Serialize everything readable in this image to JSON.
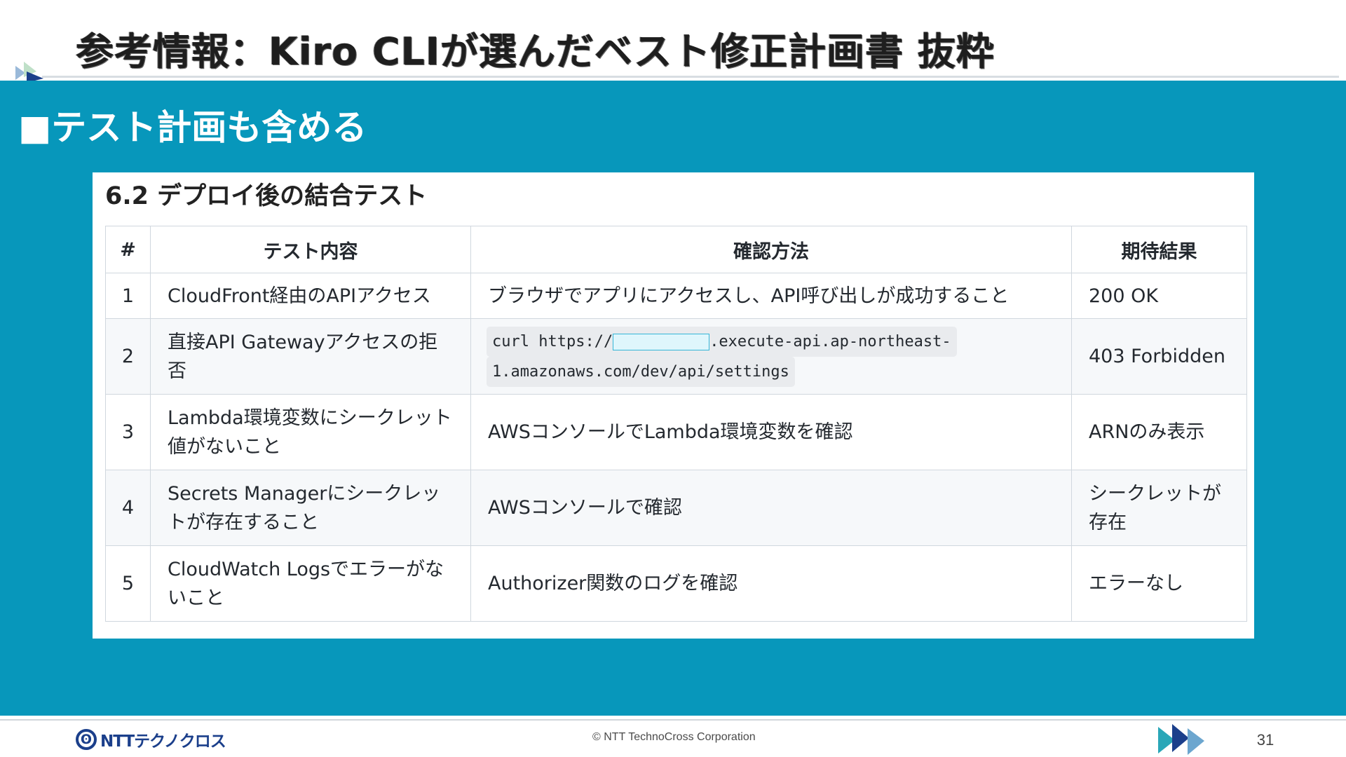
{
  "header": {
    "title": "参考情報：Kiro CLIが選んだベスト修正計画書 抜粋"
  },
  "section": {
    "heading": "■テスト計画も含める"
  },
  "card": {
    "title": "6.2 デプロイ後の結合テスト",
    "columns": [
      "#",
      "テスト内容",
      "確認方法",
      "期待結果"
    ],
    "rows": [
      {
        "num": "1",
        "content": "CloudFront経由のAPIアクセス",
        "method": "ブラウザでアプリにアクセスし、API呼び出しが成功すること",
        "expected": "200 OK"
      },
      {
        "num": "2",
        "content": "直接API Gatewayアクセスの拒否",
        "method_code": {
          "prefix": "curl https://",
          "suffix": ".execute-api.ap-northeast-",
          "line2": "1.amazonaws.com/dev/api/settings"
        },
        "expected": "403 Forbidden"
      },
      {
        "num": "3",
        "content": "Lambda環境変数にシークレット値がないこと",
        "method": "AWSコンソールでLambda環境変数を確認",
        "expected": "ARNのみ表示"
      },
      {
        "num": "4",
        "content": "Secrets Managerにシークレットが存在すること",
        "method": "AWSコンソールで確認",
        "expected": "シークレットが存在"
      },
      {
        "num": "5",
        "content": "CloudWatch Logsでエラーがないこと",
        "method": "Authorizer関数のログを確認",
        "expected": "エラーなし"
      }
    ]
  },
  "footer": {
    "logo_text": "NTTテクノクロス",
    "copyright": "© NTT TechnoCross Corporation",
    "page_number": "31"
  },
  "colors": {
    "band": "#0797bb",
    "card": "#ffffff",
    "logo": "#1b3f8b",
    "arrow_teal": "#2aa7b8",
    "arrow_navy": "#1b3f8b"
  },
  "icons": {
    "corner": "slide-corner-triangles-icon",
    "footer": "triple-arrow-icon",
    "logo": "ntt-logo-icon"
  }
}
